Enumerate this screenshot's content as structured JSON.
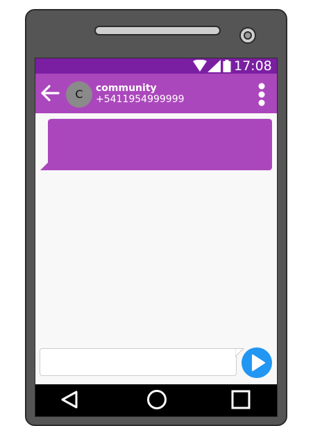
{
  "status_bar": {
    "time": "17:08",
    "background": "#7a1fa2",
    "icons": [
      "wifi-icon",
      "cell-signal-icon",
      "battery-icon"
    ]
  },
  "conversation": {
    "contact_name": "community",
    "contact_number": "+5411954999999",
    "avatar_letter": "C",
    "header_color": "#ab47bc",
    "bubble_color": "#ab47bc"
  },
  "composer": {
    "input_value": "",
    "send_button_color": "#2196f3"
  },
  "navigation": {
    "icons": [
      "back-triangle-icon",
      "home-circle-icon",
      "recents-square-icon"
    ]
  }
}
